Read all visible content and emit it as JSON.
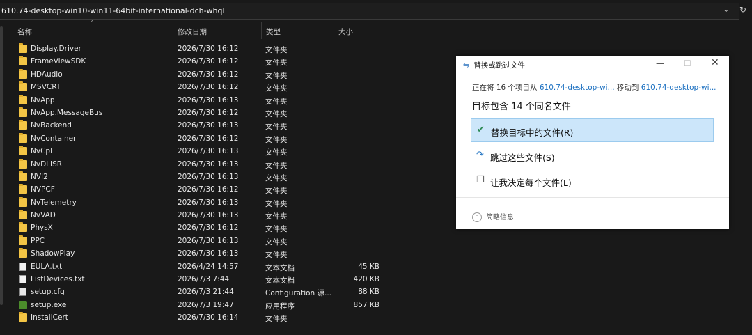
{
  "address": {
    "path": "610.74-desktop-win10-win11-64bit-international-dch-whql"
  },
  "columns": {
    "name": "名称",
    "modified": "修改日期",
    "type": "类型",
    "size": "大小"
  },
  "files": [
    {
      "name": "Display.Driver",
      "modified": "2026/7/30 16:12",
      "type": "文件夹",
      "size": "",
      "icon": "folder-icon"
    },
    {
      "name": "FrameViewSDK",
      "modified": "2026/7/30 16:12",
      "type": "文件夹",
      "size": "",
      "icon": "folder-icon"
    },
    {
      "name": "HDAudio",
      "modified": "2026/7/30 16:12",
      "type": "文件夹",
      "size": "",
      "icon": "folder-icon"
    },
    {
      "name": "MSVCRT",
      "modified": "2026/7/30 16:12",
      "type": "文件夹",
      "size": "",
      "icon": "folder-icon"
    },
    {
      "name": "NvApp",
      "modified": "2026/7/30 16:13",
      "type": "文件夹",
      "size": "",
      "icon": "folder-icon"
    },
    {
      "name": "NvApp.MessageBus",
      "modified": "2026/7/30 16:12",
      "type": "文件夹",
      "size": "",
      "icon": "folder-icon"
    },
    {
      "name": "NvBackend",
      "modified": "2026/7/30 16:13",
      "type": "文件夹",
      "size": "",
      "icon": "folder-icon"
    },
    {
      "name": "NvContainer",
      "modified": "2026/7/30 16:12",
      "type": "文件夹",
      "size": "",
      "icon": "folder-icon"
    },
    {
      "name": "NvCpl",
      "modified": "2026/7/30 16:13",
      "type": "文件夹",
      "size": "",
      "icon": "folder-icon"
    },
    {
      "name": "NvDLISR",
      "modified": "2026/7/30 16:13",
      "type": "文件夹",
      "size": "",
      "icon": "folder-icon"
    },
    {
      "name": "NVI2",
      "modified": "2026/7/30 16:13",
      "type": "文件夹",
      "size": "",
      "icon": "folder-icon"
    },
    {
      "name": "NVPCF",
      "modified": "2026/7/30 16:12",
      "type": "文件夹",
      "size": "",
      "icon": "folder-icon"
    },
    {
      "name": "NvTelemetry",
      "modified": "2026/7/30 16:13",
      "type": "文件夹",
      "size": "",
      "icon": "folder-icon"
    },
    {
      "name": "NvVAD",
      "modified": "2026/7/30 16:13",
      "type": "文件夹",
      "size": "",
      "icon": "folder-icon"
    },
    {
      "name": "PhysX",
      "modified": "2026/7/30 16:12",
      "type": "文件夹",
      "size": "",
      "icon": "folder-icon"
    },
    {
      "name": "PPC",
      "modified": "2026/7/30 16:13",
      "type": "文件夹",
      "size": "",
      "icon": "folder-icon"
    },
    {
      "name": "ShadowPlay",
      "modified": "2026/7/30 16:13",
      "type": "文件夹",
      "size": "",
      "icon": "folder-icon"
    },
    {
      "name": "EULA.txt",
      "modified": "2026/4/24 14:57",
      "type": "文本文档",
      "size": "45 KB",
      "icon": "text-file-icon"
    },
    {
      "name": "ListDevices.txt",
      "modified": "2026/7/3 7:44",
      "type": "文本文档",
      "size": "420 KB",
      "icon": "text-file-icon"
    },
    {
      "name": "setup.cfg",
      "modified": "2026/7/3 21:44",
      "type": "Configuration 源...",
      "size": "88 KB",
      "icon": "config-file-icon"
    },
    {
      "name": "setup.exe",
      "modified": "2026/7/3 19:47",
      "type": "应用程序",
      "size": "857 KB",
      "icon": "nvidia-app-icon"
    },
    {
      "name": "InstallCert",
      "modified": "2026/7/30 16:14",
      "type": "文件夹",
      "size": "",
      "icon": "folder-icon"
    }
  ],
  "dialog": {
    "title": "替换或跳过文件",
    "line1_prefix": "正在将 16 个项目从 ",
    "line1_source": "610.74-desktop-wi...",
    "line1_mid": " 移动到 ",
    "line1_dest": "610.74-desktop-wi...",
    "heading": "目标包含 14 个同名文件",
    "options": [
      {
        "label": "替换目标中的文件(R)",
        "icon": "checkmark-icon",
        "selected": true
      },
      {
        "label": "跳过这些文件(S)",
        "icon": "skip-icon",
        "selected": false
      },
      {
        "label": "让我决定每个文件(L)",
        "icon": "decide-icon",
        "selected": false
      }
    ],
    "details": "简略信息"
  }
}
